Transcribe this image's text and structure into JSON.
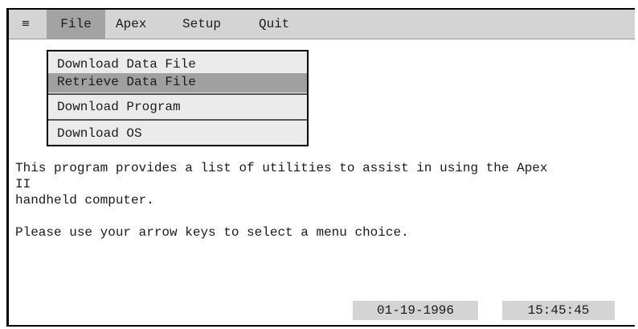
{
  "menubar": {
    "system_icon": "≡",
    "items": [
      {
        "label": "File",
        "active": true
      },
      {
        "label": "Apex",
        "active": false
      },
      {
        "label": "Setup",
        "active": false
      },
      {
        "label": "Quit",
        "active": false
      }
    ]
  },
  "file_menu": {
    "items": [
      {
        "label": "Download Data File",
        "selected": false
      },
      {
        "label": "Retrieve Data File",
        "selected": true
      },
      {
        "label": "Download Program",
        "selected": false
      },
      {
        "label": "Download OS",
        "selected": false
      }
    ]
  },
  "main": {
    "description": "This program provides a list of utilities to assist in using the Apex\nII\nhandheld computer.",
    "prompt": "Please use your arrow keys to select a menu choice."
  },
  "status": {
    "date": "01-19-1996",
    "time": "15:45:45"
  },
  "colors": {
    "menubar_bg": "#d4d4d4",
    "active_menu_bg": "#a3a3a3",
    "selected_item_bg": "#a0a0a0",
    "dropdown_bg": "#ebebeb"
  },
  "icons": {
    "system_menu": "hamburger-menu-icon"
  }
}
